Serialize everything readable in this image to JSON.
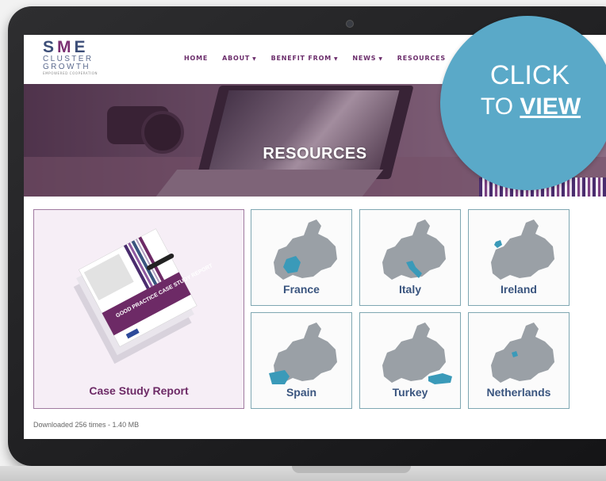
{
  "site": {
    "logo": {
      "line1_a": "S",
      "line1_m": "M",
      "line1_b": "E",
      "line2": "CLUSTER",
      "line3": "GROWTH",
      "tagline": "EMPOWERED COOPERATION"
    },
    "nav": [
      {
        "label": "HOME",
        "has_caret": false
      },
      {
        "label": "ABOUT",
        "has_caret": true
      },
      {
        "label": "BENEFIT FROM",
        "has_caret": true
      },
      {
        "label": "NEWS",
        "has_caret": true
      },
      {
        "label": "RESOURCES",
        "has_caret": false
      }
    ],
    "caret_glyph": "▼"
  },
  "hero": {
    "title": "RESOURCES"
  },
  "resources": {
    "feature": {
      "label": "Case Study Report"
    },
    "report_cover_title": "GOOD PRACTICE CASE STUDY REPORT",
    "maps": [
      {
        "label": "France",
        "icon": "europe-map-icon-france"
      },
      {
        "label": "Italy",
        "icon": "europe-map-icon-italy"
      },
      {
        "label": "Ireland",
        "icon": "europe-map-icon-ireland"
      },
      {
        "label": "Spain",
        "icon": "europe-map-icon-spain"
      },
      {
        "label": "Turkey",
        "icon": "europe-map-icon-turkey"
      },
      {
        "label": "Netherlands",
        "icon": "europe-map-icon-netherlands"
      }
    ],
    "download_info": "Downloaded 256 times - 1.40 MB"
  },
  "cta": {
    "line1": "CLICK",
    "line2_prefix": "TO",
    "line2_emph": "VIEW"
  },
  "colors": {
    "brand_purple": "#6d2a66",
    "brand_navy": "#3a557f",
    "cta_blue": "#5aa9c8",
    "highlight_teal": "#3a9ab9"
  }
}
